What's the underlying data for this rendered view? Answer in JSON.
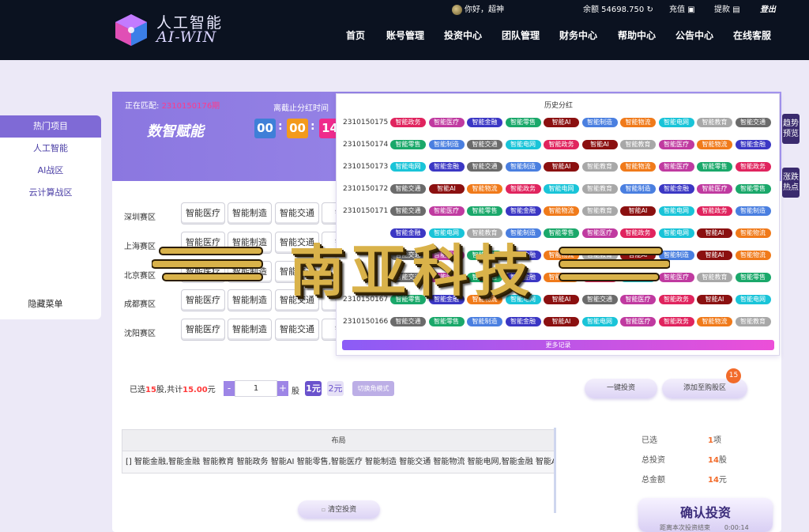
{
  "header": {
    "logo_cn": "人工智能",
    "logo_en": "AI-WIN",
    "greeting": "你好，超神",
    "balance": "余额 54698.750",
    "recharge": "充值",
    "withdraw": "提款",
    "logout": "登出",
    "nav": [
      "首页",
      "账号管理",
      "投资中心",
      "团队管理",
      "财务中心",
      "帮助中心",
      "公告中心",
      "在线客服"
    ]
  },
  "sidebar": {
    "title": "热门项目",
    "items": [
      "人工智能",
      "AI战区",
      "云计算战区"
    ],
    "hidden_menu": "隐藏菜单"
  },
  "right_tabs": {
    "trend": "趋势预览",
    "hot": "涨跌热点"
  },
  "banner": {
    "matching_label": "正在匹配:",
    "matching_value": "2310150176期",
    "deadline_label": "离截止分红时间",
    "slogan": "数智赋能",
    "timer": [
      "00",
      "00",
      "14"
    ]
  },
  "regions": [
    {
      "name": "深圳赛区",
      "chips": [
        "智能医疗",
        "智能制造",
        "智能交通",
        "智能"
      ]
    },
    {
      "name": "上海赛区",
      "chips": [
        "智能医疗",
        "智能制造",
        "智能交通",
        "智能"
      ]
    },
    {
      "name": "北京赛区",
      "chips": [
        "智能医疗",
        "智能制造",
        "智能交通",
        "智能"
      ]
    },
    {
      "name": "成都赛区",
      "chips": [
        "智能医疗",
        "智能制造",
        "智能交通",
        "智能"
      ]
    },
    {
      "name": "沈阳赛区",
      "chips": [
        "智能医疗",
        "智能制造",
        "智能交通",
        "智能"
      ]
    }
  ],
  "history": {
    "title": "历史分红",
    "more": "更多记录",
    "rows": [
      {
        "period": "2310150175",
        "tags": [
          "智能政务",
          "智能医疗",
          "智能金融",
          "智能零售",
          "智能AI",
          "智能制造",
          "智能物流",
          "智能电网",
          "智能教育",
          "智能交通"
        ]
      },
      {
        "period": "2310150174",
        "tags": [
          "智能零售",
          "智能制造",
          "智能交通",
          "智能电网",
          "智能政务",
          "智能AI",
          "智能教育",
          "智能医疗",
          "智能物流",
          "智能金融"
        ]
      },
      {
        "period": "2310150173",
        "tags": [
          "智能电网",
          "智能金融",
          "智能交通",
          "智能制造",
          "智能AI",
          "智能教育",
          "智能物流",
          "智能医疗",
          "智能零售",
          "智能政务"
        ]
      },
      {
        "period": "2310150172",
        "tags": [
          "智能交通",
          "智能AI",
          "智能物流",
          "智能政务",
          "智能电网",
          "智能教育",
          "智能制造",
          "智能金融",
          "智能医疗",
          "智能零售"
        ]
      },
      {
        "period": "2310150171",
        "tags": [
          "智能交通",
          "智能医疗",
          "智能零售",
          "智能金融",
          "智能物流",
          "智能教育",
          "智能AI",
          "智能电网",
          "智能政务",
          "智能制造"
        ]
      },
      {
        "period": "",
        "tags": [
          "智能金融",
          "智能电网",
          "智能教育",
          "智能制造",
          "智能零售",
          "智能医疗",
          "智能政务",
          "智能电网",
          "智能AI",
          "智能物流"
        ]
      },
      {
        "period": "",
        "tags": [
          "智能交通",
          "智能医疗",
          "智能零售",
          "智能金融",
          "智能物流",
          "智能教育",
          "智能AI",
          "智能制造",
          "智能AI",
          "智能物流"
        ]
      },
      {
        "period": "",
        "tags": [
          "智能交通",
          "智能医疗",
          "智能零售",
          "智能金融",
          "智能物流",
          "智能政务",
          "智能电网",
          "智能医疗",
          "智能教育",
          "智能零售"
        ]
      },
      {
        "period": "2310150167",
        "tags": [
          "智能零售",
          "智能金融",
          "智能物流",
          "智能电网",
          "智能AI",
          "智能交通",
          "智能医疗",
          "智能政务",
          "智能AI",
          "智能电网"
        ]
      },
      {
        "period": "2310150166",
        "tags": [
          "智能交通",
          "智能零售",
          "智能制造",
          "智能金融",
          "智能AI",
          "智能电网",
          "智能医疗",
          "智能政务",
          "智能物流",
          "智能教育"
        ]
      }
    ]
  },
  "tag_colors": {
    "智能政务": "#e0245e",
    "智能医疗": "#c03aa0",
    "智能金融": "#3b37c4",
    "智能零售": "#1aa86a",
    "智能AI": "#8b1010",
    "智能制造": "#4a7fe0",
    "智能物流": "#f07a1a",
    "智能电网": "#19c4d8",
    "智能教育": "#a8a8a8",
    "智能交通": "#6b6b6b"
  },
  "watermark": "南亚科技",
  "controls": {
    "selected_prefix": "已选",
    "selected_count": "15",
    "selected_mid": "股,共计",
    "total_amount": "15.00",
    "currency": "元",
    "minus": "-",
    "quantity": "1",
    "plus": "+",
    "unit": "股",
    "unit_yuan": "1元",
    "unit_jiao": "2元",
    "mode": "切换角模式",
    "one_click": "一键投资",
    "add_cart": "添加至购股区",
    "cart_count": "15"
  },
  "layout_table": {
    "header": "布局",
    "row": "[] 智能金融,智能金融 智能教育 智能政务 智能AI 智能零售,智能医疗 智能制造 智能交通 智能物流 智能电网,智能金融 智能AI,智"
  },
  "summary": {
    "selected_label": "已选",
    "selected_value": "1",
    "selected_unit": "项",
    "total_invest_label": "总投资",
    "total_invest_value": "14",
    "total_invest_unit": "股",
    "total_amount_label": "总金额",
    "total_amount_value": "14",
    "total_amount_unit": "元"
  },
  "clear_button": "清空投资",
  "confirm": {
    "title": "确认投资",
    "sub_label": "距离本次投资结束",
    "sub_time": "0:00:14"
  },
  "colors": {
    "header_bg": "#0b1220",
    "accent": "#8b77e0",
    "timer_1": "#3f7fd8",
    "timer_2": "#f39a1c",
    "timer_3": "#ef2b8c"
  }
}
